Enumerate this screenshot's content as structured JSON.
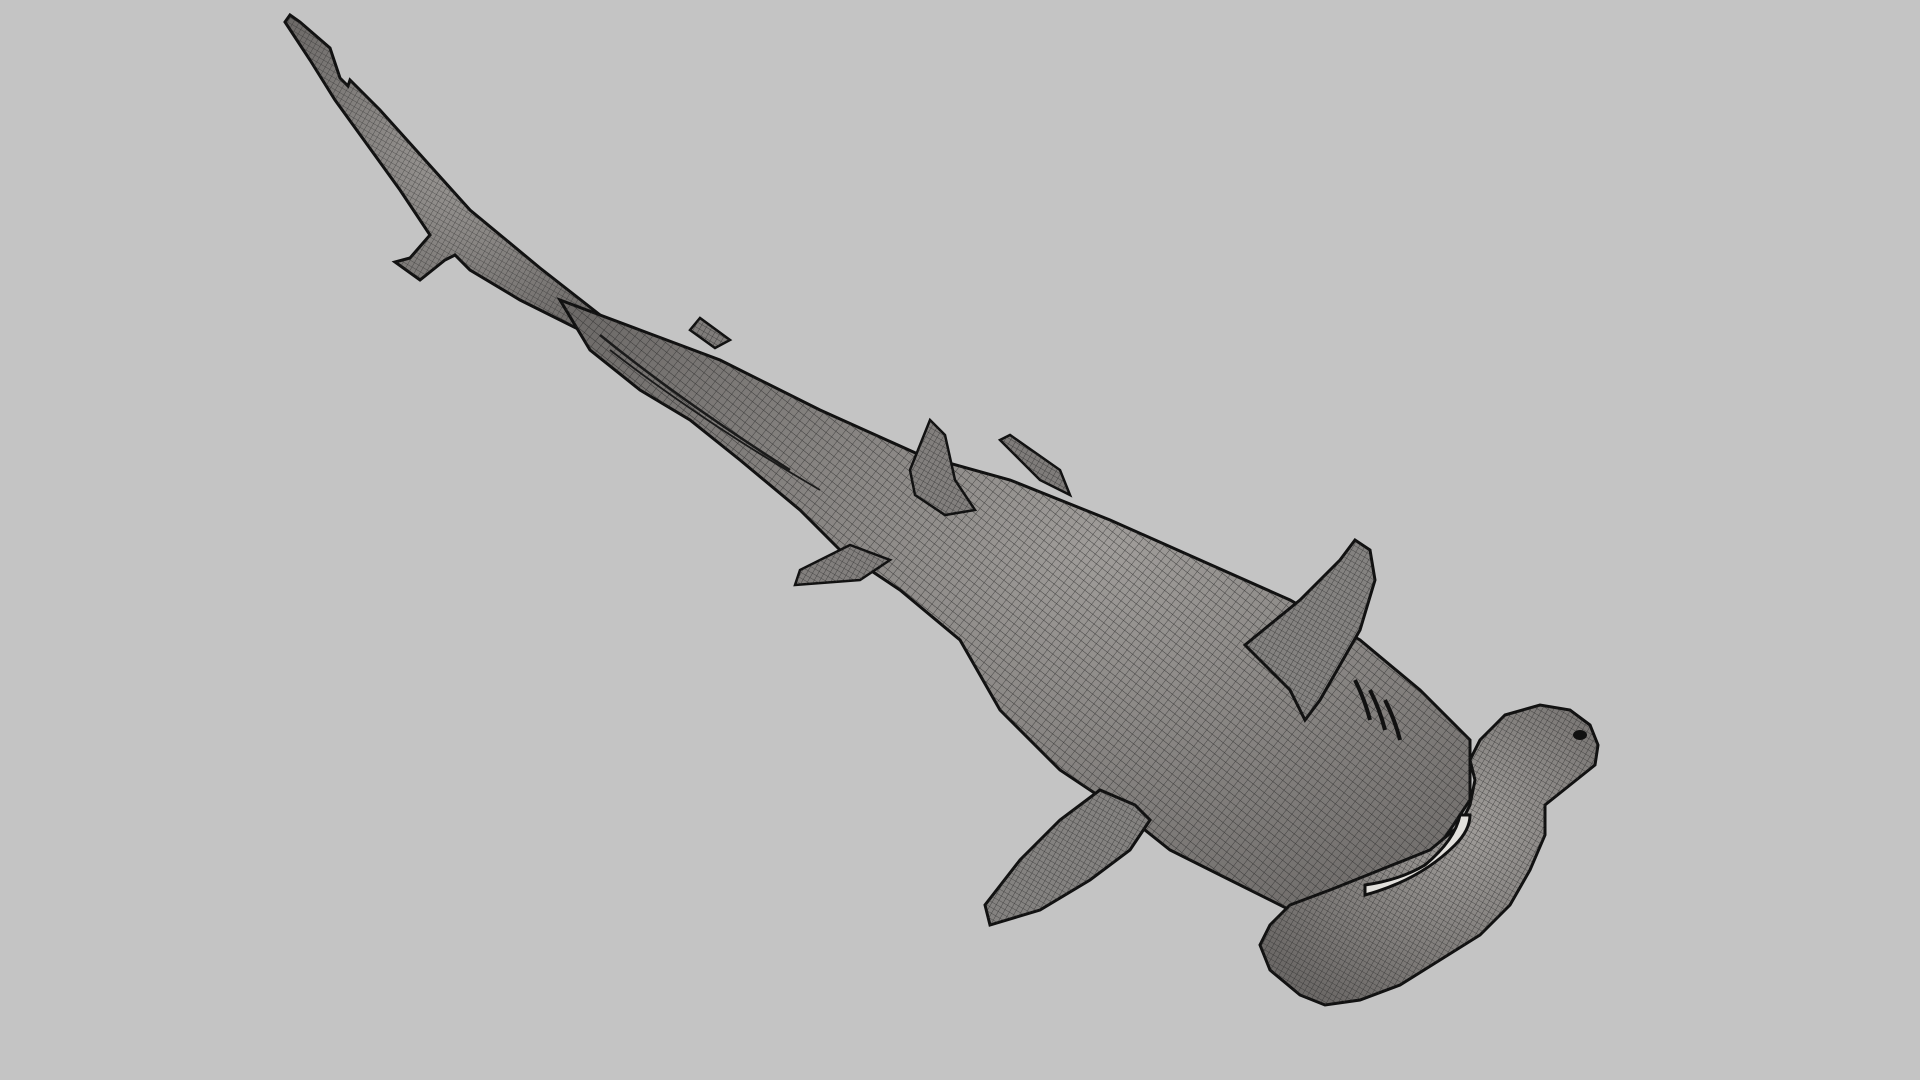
{
  "scene": {
    "background_color": "#c4c4c4",
    "subject": "hammerhead-shark-wireframe-render",
    "colors": {
      "body_fill": "#8a8785",
      "body_shadow": "#6f6c6a",
      "fin_fill": "#827f7d",
      "wire": "#2a2a2a",
      "outline": "#111111",
      "mouth": "#e2e0dc"
    }
  }
}
